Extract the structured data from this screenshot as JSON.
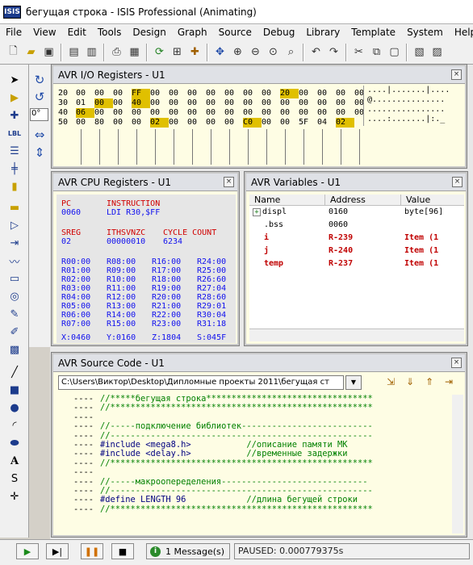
{
  "window": {
    "title": "бегущая строка - ISIS Professional (Animating)",
    "icon": "ISIS"
  },
  "menu": [
    "File",
    "View",
    "Edit",
    "Tools",
    "Design",
    "Graph",
    "Source",
    "Debug",
    "Library",
    "Template",
    "System",
    "Help"
  ],
  "io": {
    "title": "AVR I/O Registers - U1",
    "rows": [
      {
        "addr": "20",
        "cells": [
          "00",
          "00",
          "00",
          "FF",
          "00",
          "00",
          "00",
          "00",
          "00",
          "00",
          "00",
          "20",
          "00",
          "00",
          "00",
          "00"
        ]
      },
      {
        "addr": "30",
        "cells": [
          "01",
          "00",
          "00",
          "40",
          "00",
          "00",
          "00",
          "00",
          "00",
          "00",
          "00",
          "00",
          "00",
          "00",
          "00",
          "00"
        ]
      },
      {
        "addr": "40",
        "cells": [
          "06",
          "00",
          "00",
          "00",
          "00",
          "00",
          "00",
          "00",
          "00",
          "00",
          "00",
          "00",
          "00",
          "00",
          "00",
          "00"
        ]
      },
      {
        "addr": "50",
        "cells": [
          "00",
          "80",
          "00",
          "00",
          "02",
          "00",
          "00",
          "00",
          "00",
          "C0",
          "00",
          "00",
          "5F",
          "04",
          "02",
          ""
        ]
      }
    ],
    "ascii": [
      "....|.......|....",
      "@...............",
      "................",
      "....:.......|:._"
    ]
  },
  "cpu": {
    "title": "AVR CPU Registers - U1",
    "pc_label": "PC",
    "pc_value": "0060",
    "instr_label": "INSTRUCTION",
    "instr_value": "LDI R30,$FF",
    "sreg_label": "SREG",
    "sreg_value": "02",
    "flags_label": "ITHSVNZC",
    "flags_value": "00000010",
    "cycle_label": "CYCLE COUNT",
    "cycle_value": "6234",
    "regs": [
      [
        "R00:00",
        "R08:00",
        "R16:00",
        "R24:00"
      ],
      [
        "R01:00",
        "R09:00",
        "R17:00",
        "R25:00"
      ],
      [
        "R02:00",
        "R10:00",
        "R18:00",
        "R26:60"
      ],
      [
        "R03:00",
        "R11:00",
        "R19:00",
        "R27:04"
      ],
      [
        "R04:00",
        "R12:00",
        "R20:00",
        "R28:60"
      ],
      [
        "R05:00",
        "R13:00",
        "R21:00",
        "R29:01"
      ],
      [
        "R06:00",
        "R14:00",
        "R22:00",
        "R30:04"
      ],
      [
        "R07:00",
        "R15:00",
        "R23:00",
        "R31:18"
      ]
    ],
    "ptrs": [
      "X:0460",
      "Y:0160",
      "Z:1804",
      "S:045F"
    ]
  },
  "vars": {
    "title": "AVR Variables - U1",
    "columns": [
      "Name",
      "Address",
      "Value"
    ],
    "rows": [
      {
        "name": "displ",
        "address": "0160",
        "value": "byte[96]",
        "style": "normal",
        "expand": "+"
      },
      {
        "name": ".bss",
        "address": "0060",
        "value": "",
        "style": "normal",
        "expand": ""
      },
      {
        "name": "i",
        "address": "R-239",
        "value": "Item (1",
        "style": "red",
        "expand": ""
      },
      {
        "name": "j",
        "address": "R-240",
        "value": "Item (1",
        "style": "red",
        "expand": ""
      },
      {
        "name": "temp",
        "address": "R-237",
        "value": "Item (1",
        "style": "red",
        "expand": ""
      }
    ]
  },
  "source": {
    "title": "AVR Source Code - U1",
    "path": "C:\\Users\\Виктор\\Desktop\\Дипломные проекты 2011\\бегущая ст",
    "lines": [
      {
        "m": "----",
        "t": "//*****бегущая строка*********************************",
        "k": "cmt"
      },
      {
        "m": "----",
        "t": "//****************************************************",
        "k": "cmt"
      },
      {
        "m": "----",
        "t": "",
        "k": "code"
      },
      {
        "m": "----",
        "t": "//-----подключение библиотек--------------------------",
        "k": "cmt"
      },
      {
        "m": "----",
        "t": "//----------------------------------------------------",
        "k": "cmt"
      },
      {
        "m": "----",
        "t": "#include <mega8.h>           //описание памяти МК",
        "k": "mix"
      },
      {
        "m": "----",
        "t": "#include <delay.h>           //временные задержки",
        "k": "mix"
      },
      {
        "m": "----",
        "t": "//****************************************************",
        "k": "cmt"
      },
      {
        "m": "----",
        "t": "",
        "k": "code"
      },
      {
        "m": "----",
        "t": "//-----макроопеределения-----------------------------",
        "k": "cmt"
      },
      {
        "m": "----",
        "t": "//----------------------------------------------------",
        "k": "cmt"
      },
      {
        "m": "----",
        "t": "#define LENGTH 96            //длина бегущей строки",
        "k": "mix"
      },
      {
        "m": "----",
        "t": "//****************************************************",
        "k": "cmt"
      }
    ]
  },
  "status": {
    "messages": "1 Message(s)",
    "paused": "PAUSED: 0.000779375s"
  },
  "colors": {
    "highlight": "#e0c000",
    "red": "#c00000",
    "blue": "#1010ee",
    "comment": "#008000"
  }
}
